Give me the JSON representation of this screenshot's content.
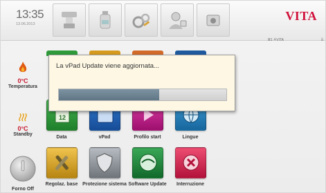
{
  "header": {
    "time": "13:35",
    "date": "13.06.2013",
    "logo": "VITA",
    "status_text": "≣1 ≜VITA",
    "status_mark": "ä",
    "icons": [
      {
        "name": "furnace-icon"
      },
      {
        "name": "bottle-icon"
      },
      {
        "name": "tools-gear-icon"
      },
      {
        "name": "user-headset-icon"
      },
      {
        "name": "camera-icon"
      }
    ]
  },
  "left_panel": {
    "temperature": {
      "value": "0°C",
      "label": "Temperatura"
    },
    "standby": {
      "value": "0°C",
      "label": "Standby"
    },
    "power": {
      "label": "Forno Off"
    }
  },
  "tiles": [
    {
      "label": "Data",
      "color": "#2f9a3a"
    },
    {
      "label": "vPad",
      "color": "#1c5fb4"
    },
    {
      "label": "Profilo start",
      "color": "#c2168b"
    },
    {
      "label": "Lingue",
      "color": "#1f80b8"
    },
    {
      "label": "Regolaz. base",
      "color": "#d8a62e"
    },
    {
      "label": "Protezione sistema",
      "color": "#8a8f96"
    },
    {
      "label": "Software Update",
      "color": "#1e8a3c"
    },
    {
      "label": "Interruzione",
      "color": "#d8244e"
    }
  ],
  "dialog": {
    "message": "La vPad Update viene aggiornata...",
    "progress": 0.6
  },
  "colors": {
    "accent": "#d0103a",
    "dialog_bg": "#fdf7e4",
    "progress_fill": "#607786"
  }
}
